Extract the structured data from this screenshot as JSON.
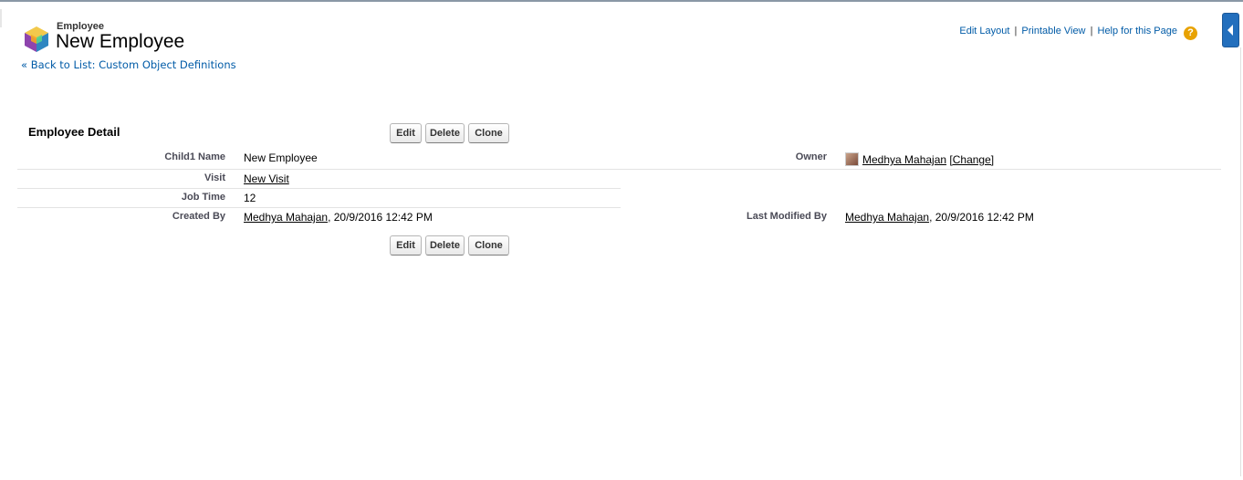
{
  "header": {
    "object_type": "Employee",
    "record_title": "New Employee",
    "back_link_chevron": "«",
    "back_link": "Back to List: Custom Object Definitions"
  },
  "top_links": {
    "edit_layout": "Edit Layout",
    "printable_view": "Printable View",
    "help": "Help for this Page",
    "separator": "|",
    "help_icon_glyph": "?"
  },
  "detail": {
    "section_title": "Employee Detail",
    "buttons": {
      "edit": "Edit",
      "delete": "Delete",
      "clone": "Clone"
    },
    "fields": {
      "child1_name": {
        "label": "Child1 Name",
        "value": "New Employee"
      },
      "owner": {
        "label": "Owner",
        "value": "Medhya Mahajan",
        "change": "[Change]"
      },
      "visit": {
        "label": "Visit",
        "value": "New Visit"
      },
      "job_time": {
        "label": "Job Time",
        "value": "12"
      },
      "created_by": {
        "label": "Created By",
        "user": "Medhya Mahajan",
        "date": ", 20/9/2016 12:42 PM"
      },
      "last_modified_by": {
        "label": "Last Modified By",
        "user": "Medhya Mahajan",
        "date": ", 20/9/2016 12:42 PM"
      }
    }
  },
  "colors": {
    "link": "#015ba7",
    "help_icon": "#e8a202",
    "side_tab": "#236fbd"
  },
  "icons": [
    "custom-object-cube-icon",
    "help-icon",
    "collapse-sidebar-icon",
    "user-avatar-icon"
  ]
}
